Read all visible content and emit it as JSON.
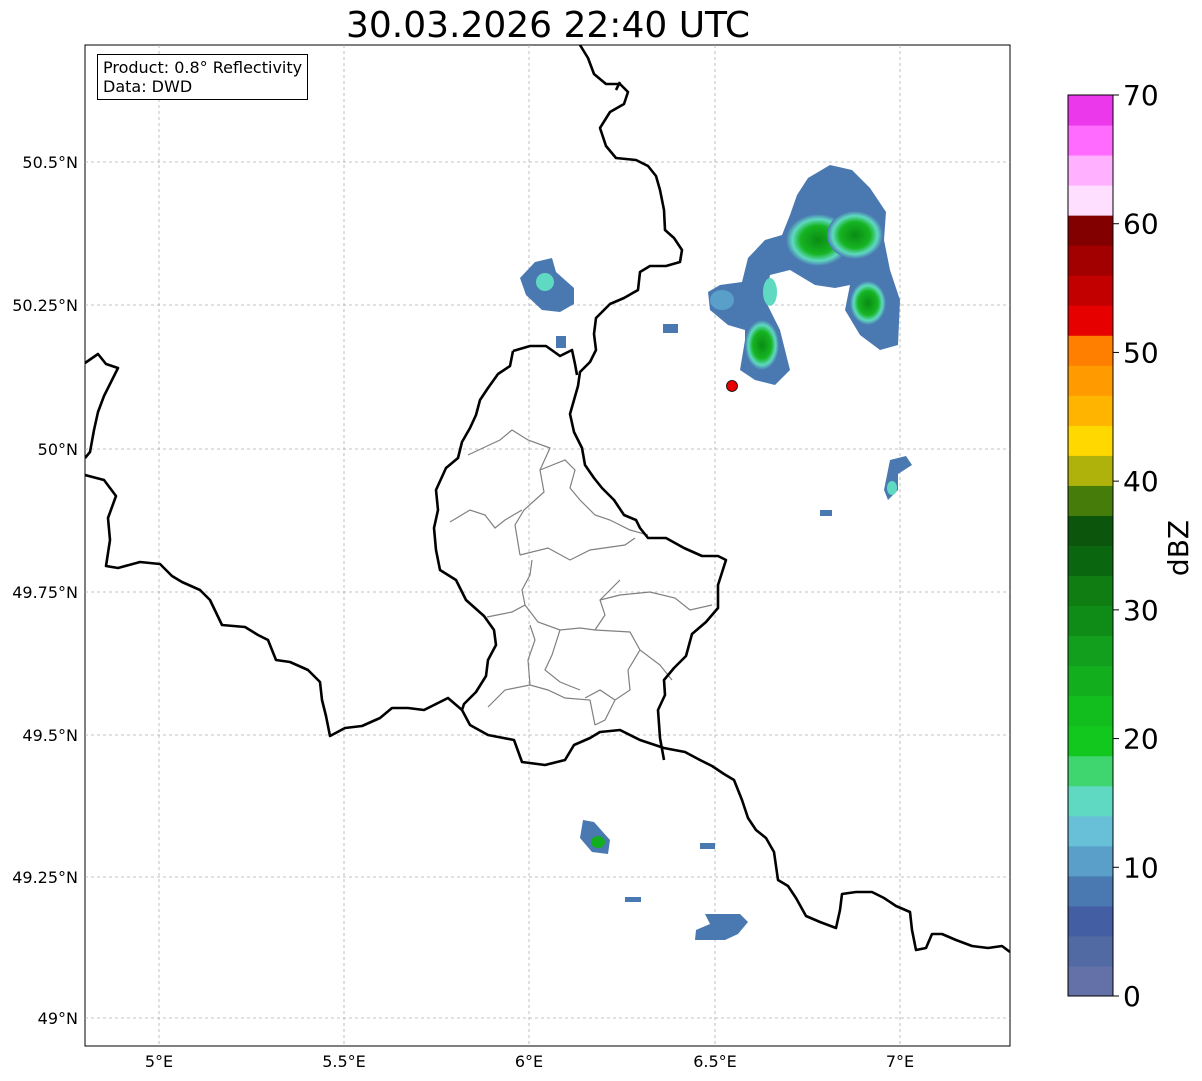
{
  "title": "30.03.2026 22:40 UTC",
  "info_box": {
    "product": "Product: 0.8° Reflectivity",
    "data_source": "Data: DWD"
  },
  "axes": {
    "lon_ticks": [
      "5°E",
      "5.5°E",
      "6°E",
      "6.5°E",
      "7°E"
    ],
    "lat_ticks": [
      "50.5°N",
      "50.25°N",
      "50°N",
      "49.75°N",
      "49.5°N",
      "49.25°N",
      "49°N"
    ]
  },
  "colorbar": {
    "label": "dBZ",
    "ticks": [
      "0",
      "10",
      "20",
      "30",
      "40",
      "50",
      "60",
      "70"
    ],
    "colors": [
      "#6471a8",
      "#526aa3",
      "#435ea3",
      "#4a79b1",
      "#5a9fc9",
      "#67c0d8",
      "#5fd9c1",
      "#3fd66f",
      "#12c81e",
      "#12be1e",
      "#12ae1e",
      "#129f1e",
      "#0f8c18",
      "#0f7d12",
      "#0b6610",
      "#0b560c",
      "#467c0a",
      "#afb20a",
      "#ffd800",
      "#ffb400",
      "#ff9b00",
      "#ff7f00",
      "#e60000",
      "#c30000",
      "#a20000",
      "#820000",
      "#ffdfff",
      "#ffb0ff",
      "#ff6bff",
      "#eb38eb"
    ]
  },
  "radar_site_color": "#e60000",
  "grid": true
}
